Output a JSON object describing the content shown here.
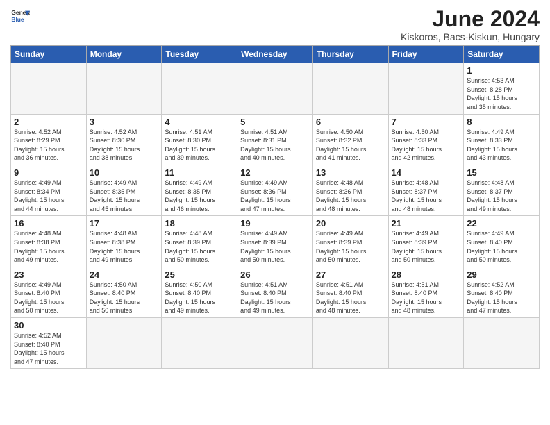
{
  "header": {
    "logo_general": "General",
    "logo_blue": "Blue",
    "title": "June 2024",
    "subtitle": "Kiskoros, Bacs-Kiskun, Hungary"
  },
  "days_of_week": [
    "Sunday",
    "Monday",
    "Tuesday",
    "Wednesday",
    "Thursday",
    "Friday",
    "Saturday"
  ],
  "weeks": [
    [
      {
        "day": "",
        "info": "",
        "empty": true
      },
      {
        "day": "",
        "info": "",
        "empty": true
      },
      {
        "day": "",
        "info": "",
        "empty": true
      },
      {
        "day": "",
        "info": "",
        "empty": true
      },
      {
        "day": "",
        "info": "",
        "empty": true
      },
      {
        "day": "",
        "info": "",
        "empty": true
      },
      {
        "day": "1",
        "info": "Sunrise: 4:53 AM\nSunset: 8:28 PM\nDaylight: 15 hours\nand 35 minutes."
      }
    ],
    [
      {
        "day": "2",
        "info": "Sunrise: 4:52 AM\nSunset: 8:29 PM\nDaylight: 15 hours\nand 36 minutes."
      },
      {
        "day": "3",
        "info": "Sunrise: 4:52 AM\nSunset: 8:30 PM\nDaylight: 15 hours\nand 38 minutes."
      },
      {
        "day": "4",
        "info": "Sunrise: 4:51 AM\nSunset: 8:30 PM\nDaylight: 15 hours\nand 39 minutes."
      },
      {
        "day": "5",
        "info": "Sunrise: 4:51 AM\nSunset: 8:31 PM\nDaylight: 15 hours\nand 40 minutes."
      },
      {
        "day": "6",
        "info": "Sunrise: 4:50 AM\nSunset: 8:32 PM\nDaylight: 15 hours\nand 41 minutes."
      },
      {
        "day": "7",
        "info": "Sunrise: 4:50 AM\nSunset: 8:33 PM\nDaylight: 15 hours\nand 42 minutes."
      },
      {
        "day": "8",
        "info": "Sunrise: 4:49 AM\nSunset: 8:33 PM\nDaylight: 15 hours\nand 43 minutes."
      }
    ],
    [
      {
        "day": "9",
        "info": "Sunrise: 4:49 AM\nSunset: 8:34 PM\nDaylight: 15 hours\nand 44 minutes."
      },
      {
        "day": "10",
        "info": "Sunrise: 4:49 AM\nSunset: 8:35 PM\nDaylight: 15 hours\nand 45 minutes."
      },
      {
        "day": "11",
        "info": "Sunrise: 4:49 AM\nSunset: 8:35 PM\nDaylight: 15 hours\nand 46 minutes."
      },
      {
        "day": "12",
        "info": "Sunrise: 4:49 AM\nSunset: 8:36 PM\nDaylight: 15 hours\nand 47 minutes."
      },
      {
        "day": "13",
        "info": "Sunrise: 4:48 AM\nSunset: 8:36 PM\nDaylight: 15 hours\nand 48 minutes."
      },
      {
        "day": "14",
        "info": "Sunrise: 4:48 AM\nSunset: 8:37 PM\nDaylight: 15 hours\nand 48 minutes."
      },
      {
        "day": "15",
        "info": "Sunrise: 4:48 AM\nSunset: 8:37 PM\nDaylight: 15 hours\nand 49 minutes."
      }
    ],
    [
      {
        "day": "16",
        "info": "Sunrise: 4:48 AM\nSunset: 8:38 PM\nDaylight: 15 hours\nand 49 minutes."
      },
      {
        "day": "17",
        "info": "Sunrise: 4:48 AM\nSunset: 8:38 PM\nDaylight: 15 hours\nand 49 minutes."
      },
      {
        "day": "18",
        "info": "Sunrise: 4:48 AM\nSunset: 8:39 PM\nDaylight: 15 hours\nand 50 minutes."
      },
      {
        "day": "19",
        "info": "Sunrise: 4:49 AM\nSunset: 8:39 PM\nDaylight: 15 hours\nand 50 minutes."
      },
      {
        "day": "20",
        "info": "Sunrise: 4:49 AM\nSunset: 8:39 PM\nDaylight: 15 hours\nand 50 minutes."
      },
      {
        "day": "21",
        "info": "Sunrise: 4:49 AM\nSunset: 8:39 PM\nDaylight: 15 hours\nand 50 minutes."
      },
      {
        "day": "22",
        "info": "Sunrise: 4:49 AM\nSunset: 8:40 PM\nDaylight: 15 hours\nand 50 minutes."
      }
    ],
    [
      {
        "day": "23",
        "info": "Sunrise: 4:49 AM\nSunset: 8:40 PM\nDaylight: 15 hours\nand 50 minutes."
      },
      {
        "day": "24",
        "info": "Sunrise: 4:50 AM\nSunset: 8:40 PM\nDaylight: 15 hours\nand 50 minutes."
      },
      {
        "day": "25",
        "info": "Sunrise: 4:50 AM\nSunset: 8:40 PM\nDaylight: 15 hours\nand 49 minutes."
      },
      {
        "day": "26",
        "info": "Sunrise: 4:51 AM\nSunset: 8:40 PM\nDaylight: 15 hours\nand 49 minutes."
      },
      {
        "day": "27",
        "info": "Sunrise: 4:51 AM\nSunset: 8:40 PM\nDaylight: 15 hours\nand 48 minutes."
      },
      {
        "day": "28",
        "info": "Sunrise: 4:51 AM\nSunset: 8:40 PM\nDaylight: 15 hours\nand 48 minutes."
      },
      {
        "day": "29",
        "info": "Sunrise: 4:52 AM\nSunset: 8:40 PM\nDaylight: 15 hours\nand 47 minutes."
      }
    ],
    [
      {
        "day": "30",
        "info": "Sunrise: 4:52 AM\nSunset: 8:40 PM\nDaylight: 15 hours\nand 47 minutes."
      },
      {
        "day": "",
        "info": "",
        "empty": true
      },
      {
        "day": "",
        "info": "",
        "empty": true
      },
      {
        "day": "",
        "info": "",
        "empty": true
      },
      {
        "day": "",
        "info": "",
        "empty": true
      },
      {
        "day": "",
        "info": "",
        "empty": true
      },
      {
        "day": "",
        "info": "",
        "empty": true
      }
    ]
  ]
}
